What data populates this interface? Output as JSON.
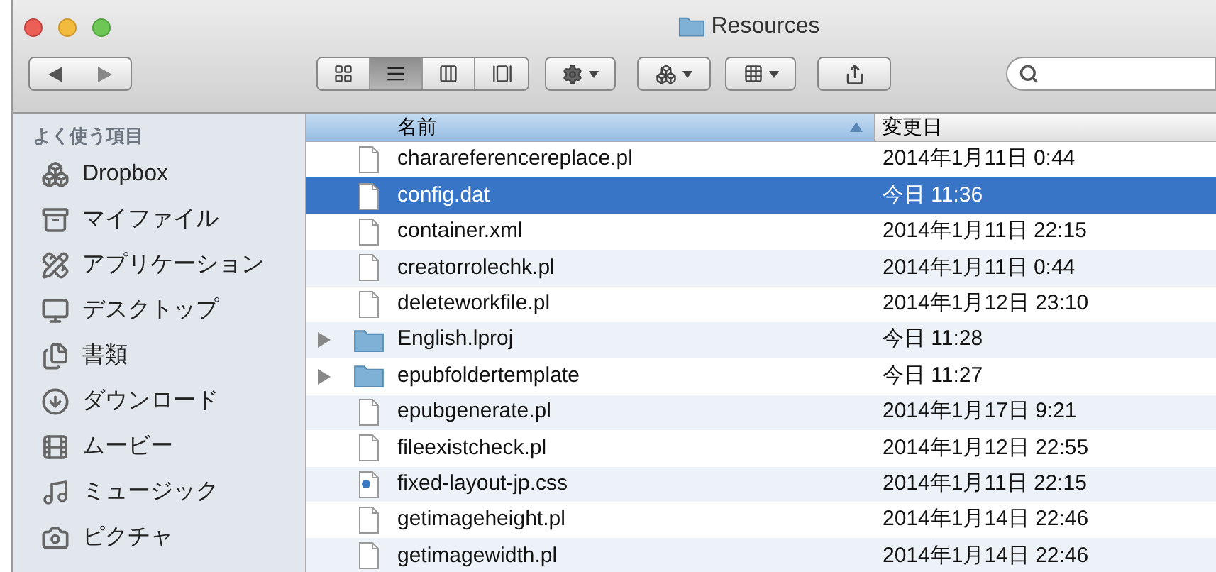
{
  "window": {
    "title": "Resources"
  },
  "toolbar": {
    "view_modes": [
      {
        "selected": false
      },
      {
        "selected": true
      },
      {
        "selected": false
      },
      {
        "selected": false
      }
    ]
  },
  "sidebar": {
    "heading": "よく使う項目",
    "items": [
      {
        "label": "Dropbox"
      },
      {
        "label": "マイファイル"
      },
      {
        "label": "アプリケーション"
      },
      {
        "label": "デスクトップ"
      },
      {
        "label": "書類"
      },
      {
        "label": "ダウンロード"
      },
      {
        "label": "ムービー"
      },
      {
        "label": "ミュージック"
      },
      {
        "label": "ピクチャ"
      }
    ]
  },
  "table": {
    "columns": [
      {
        "label": "名前",
        "sorted": true
      },
      {
        "label": "変更日",
        "sorted": false
      }
    ],
    "rows": [
      {
        "kind": "file",
        "name": "charareferencereplace.pl",
        "date": "2014年1月11日 0:44",
        "selected": false
      },
      {
        "kind": "file",
        "name": "config.dat",
        "date": "今日 11:36",
        "selected": true
      },
      {
        "kind": "file",
        "name": "container.xml",
        "date": "2014年1月11日 22:15",
        "selected": false
      },
      {
        "kind": "file",
        "name": "creatorrolechk.pl",
        "date": "2014年1月11日 0:44",
        "selected": false
      },
      {
        "kind": "file",
        "name": "deleteworkfile.pl",
        "date": "2014年1月12日 23:10",
        "selected": false
      },
      {
        "kind": "folder",
        "name": "English.lproj",
        "date": "今日 11:28",
        "selected": false
      },
      {
        "kind": "folder",
        "name": "epubfoldertemplate",
        "date": "今日 11:27",
        "selected": false
      },
      {
        "kind": "file",
        "name": "epubgenerate.pl",
        "date": "2014年1月17日 9:21",
        "selected": false
      },
      {
        "kind": "file",
        "name": "fileexistcheck.pl",
        "date": "2014年1月12日 22:55",
        "selected": false
      },
      {
        "kind": "css",
        "name": "fixed-layout-jp.css",
        "date": "2014年1月11日 22:15",
        "selected": false
      },
      {
        "kind": "file",
        "name": "getimageheight.pl",
        "date": "2014年1月14日 22:46",
        "selected": false
      },
      {
        "kind": "file",
        "name": "getimagewidth.pl",
        "date": "2014年1月14日 22:46",
        "selected": false
      }
    ]
  }
}
